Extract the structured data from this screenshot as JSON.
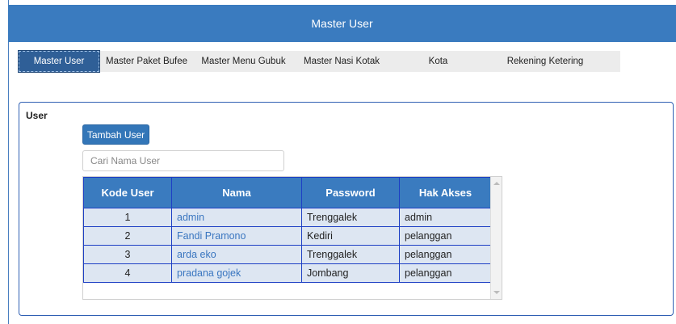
{
  "header": {
    "title": "Master User"
  },
  "tabs": [
    {
      "label": "Master User",
      "active": true
    },
    {
      "label": "Master Paket Bufee",
      "active": false
    },
    {
      "label": "Master Menu Gubuk",
      "active": false
    },
    {
      "label": "Master Nasi Kotak",
      "active": false
    },
    {
      "label": "Kota",
      "active": false
    },
    {
      "label": "Rekening Ketering",
      "active": false
    }
  ],
  "panel": {
    "title": "User",
    "add_button": "Tambah User",
    "search_placeholder": "Cari Nama User"
  },
  "table": {
    "columns": [
      "Kode User",
      "Nama",
      "Password",
      "Hak Akses"
    ],
    "rows": [
      {
        "kode": "1",
        "nama": "admin",
        "password": "Trenggalek",
        "hak": "admin"
      },
      {
        "kode": "2",
        "nama": "Fandi Pramono",
        "password": "Kediri",
        "hak": "pelanggan"
      },
      {
        "kode": "3",
        "nama": "arda eko",
        "password": "Trenggalek",
        "hak": "pelanggan"
      },
      {
        "kode": "4",
        "nama": "pradana gojek",
        "password": "Jombang",
        "hak": "pelanggan"
      }
    ]
  },
  "colors": {
    "accent": "#3a7bbf",
    "border": "#1d3fc4",
    "row_bg": "#dde6f2",
    "link": "#3a76c0"
  }
}
